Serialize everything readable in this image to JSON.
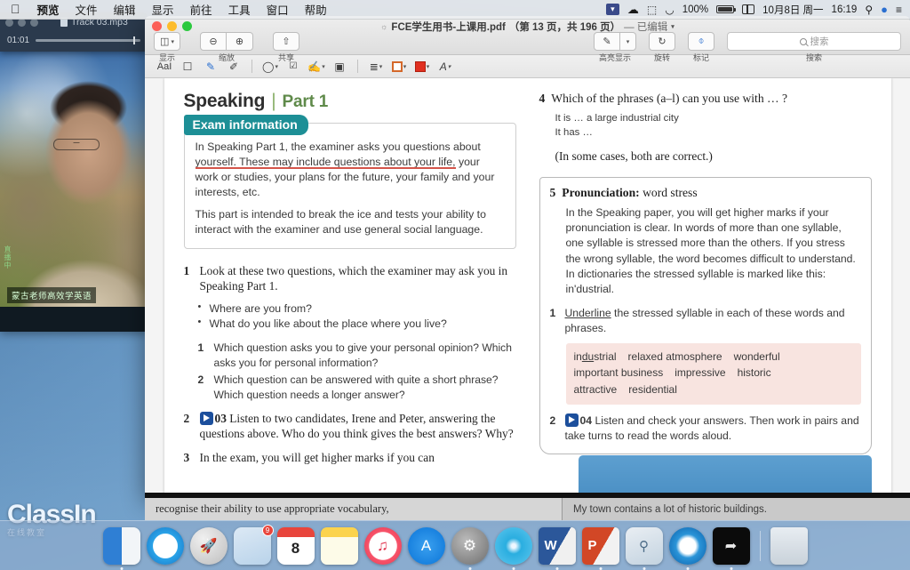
{
  "menubar": {
    "apple_icon": "apple-icon",
    "items": [
      "预览",
      "文件",
      "编辑",
      "显示",
      "前往",
      "工具",
      "窗口",
      "帮助"
    ],
    "status": {
      "battery_percent": "100%",
      "date": "10月8日 周一",
      "time": "16:19",
      "icons": [
        "flag-icon",
        "cloud-icon",
        "bluetooth-icon",
        "wifi-icon",
        "battery-icon",
        "control-center-icon",
        "search-icon",
        "siri-icon",
        "notification-center-icon"
      ]
    }
  },
  "audio_window": {
    "title": "Track 03.mp3",
    "current_time": "01:01"
  },
  "camera_panel": {
    "caption": "蒙古老师高效学英语",
    "vertical_label": "直播中"
  },
  "classin": {
    "name": "ClassIn",
    "tagline": "在线教室"
  },
  "pdf_window": {
    "title": "FCE学生用书-上课用.pdf",
    "page_info": "（第 13 页，共 196 页）",
    "edited_state": "— 已编辑",
    "toolbar": {
      "groups": [
        {
          "label": "显示",
          "buttons": [
            {
              "icon": "sidebar-icon",
              "caret": "▾"
            }
          ]
        },
        {
          "label": "缩放",
          "buttons": [
            {
              "icon": "zoom-out-icon"
            },
            {
              "icon": "zoom-in-icon"
            }
          ]
        },
        {
          "label": "共享",
          "buttons": [
            {
              "icon": "share-icon"
            }
          ]
        }
      ],
      "right_groups": [
        {
          "label": "高亮显示",
          "buttons": [
            {
              "icon": "highlighter-icon"
            },
            {
              "icon": "chevron-down-icon"
            }
          ]
        },
        {
          "label": "旋转",
          "buttons": [
            {
              "icon": "rotate-icon"
            }
          ]
        },
        {
          "label": "标记",
          "buttons": [
            {
              "icon": "markup-icon"
            }
          ]
        }
      ],
      "search_label": "搜索",
      "search_placeholder": "搜索"
    },
    "markup_bar": [
      {
        "icon": "text-select-icon",
        "glyph": "AaI"
      },
      {
        "icon": "rect-select-icon",
        "glyph": "▢"
      },
      {
        "icon": "instant-alpha-icon",
        "glyph": "✐"
      },
      {
        "icon": "sketch-icon",
        "glyph": "✎"
      },
      {
        "icon": "shapes-icon",
        "glyph": "◌",
        "caret": "▾"
      },
      {
        "icon": "text-box-icon",
        "glyph": "T"
      },
      {
        "icon": "signature-icon",
        "glyph": "✑",
        "caret": "▾"
      },
      {
        "icon": "note-icon",
        "glyph": "▣"
      },
      {
        "icon": "align-icon",
        "glyph": "≡",
        "caret": "▾"
      },
      {
        "icon": "border-style-icon",
        "glyph": "",
        "caret": "▾"
      },
      {
        "icon": "fill-color-icon",
        "glyph": "",
        "caret": "▾"
      },
      {
        "icon": "font-style-icon",
        "glyph": "A",
        "caret": "▾"
      }
    ]
  },
  "page_content": {
    "heading": {
      "title": "Speaking",
      "divider": "|",
      "part": "Part 1"
    },
    "exam_box": {
      "tag": "Exam information",
      "paragraph1_underlined": "In Speaking Part 1, the examiner asks you questions about yourself. These may include questions about your life,",
      "paragraph1_rest": "your work or studies, your plans for the future, your family and your interests, etc.",
      "paragraph2": "This part is intended to break the ice and tests your ability to interact with the examiner and use general social language."
    },
    "left_exercises": [
      {
        "number": "1",
        "text": "Look at these two questions, which the examiner may ask you in Speaking Part 1.",
        "bullets": [
          "Where are you from?",
          "What do you like about the place where you live?"
        ],
        "subitems": [
          {
            "number": "1",
            "text": "Which question asks you to give your personal opinion? Which asks you for personal information?"
          },
          {
            "number": "2",
            "text": "Which question can be answered with quite a short phrase? Which question needs a longer answer?"
          }
        ]
      },
      {
        "number": "2",
        "audio_icon": "play-icon",
        "audio_track": "03",
        "text": "Listen to two candidates, Irene and Peter, answering the questions above. Who do you think gives the best answers? Why?"
      },
      {
        "number": "3",
        "text": "In the exam, you will get higher marks if you can"
      }
    ],
    "right_exercises": [
      {
        "number": "4",
        "text": "Which of the phrases (a–l) can you use with … ?",
        "sub_lines": [
          "It is … a large industrial city",
          "It has …"
        ],
        "note": "(In some cases, both are correct.)"
      }
    ],
    "pronunciation_box": {
      "number": "5",
      "title_bold": "Pronunciation:",
      "title_rest": "word stress",
      "paragraph": "In the Speaking paper, you will get higher marks if your pronunciation is clear. In words of more than one syllable, one syllable is stressed more than the others. If you stress the wrong syllable, the word becomes difficult to understand. In dictionaries the stressed syllable is marked like this: in'dustrial.",
      "items": [
        {
          "number": "1",
          "underlined_word": "Underline",
          "text": " the stressed syllable in each of these words and phrases."
        },
        {
          "number": "2",
          "audio_icon": "play-icon",
          "audio_track": "04",
          "text": "Listen and check your answers. Then work in pairs and take turns to read the words aloud."
        }
      ],
      "word_list": [
        "industrial",
        "relaxed atmosphere",
        "wonderful",
        "important business",
        "impressive",
        "historic",
        "attractive",
        "residential"
      ],
      "word_list_stress": "du"
    }
  },
  "bottom_strip": {
    "hidden_line": "recognise their ability to use appropriate vocabulary,",
    "right_text": "My town contains a lot of historic buildings."
  },
  "dock": {
    "items": [
      {
        "name": "finder",
        "label": "Finder",
        "glyph": ""
      },
      {
        "name": "safari",
        "label": "Safari",
        "glyph": ""
      },
      {
        "name": "launchpad",
        "label": "Launchpad",
        "glyph": "🚀"
      },
      {
        "name": "mail",
        "label": "Mail",
        "glyph": "",
        "badge": "9"
      },
      {
        "name": "calendar",
        "label": "Calendar",
        "glyph": "8"
      },
      {
        "name": "notes",
        "label": "Notes",
        "glyph": ""
      },
      {
        "name": "itunes",
        "label": "iTunes",
        "glyph": "♪"
      },
      {
        "name": "app-store",
        "label": "App Store",
        "glyph": "A"
      },
      {
        "name": "system-preferences",
        "label": "System Preferences",
        "glyph": "⚙"
      },
      {
        "name": "wechat",
        "label": "WeChat",
        "glyph": ""
      },
      {
        "name": "microsoft-word",
        "label": "Word",
        "glyph": "W"
      },
      {
        "name": "powerpoint",
        "label": "PowerPoint",
        "glyph": "P"
      },
      {
        "name": "preview",
        "label": "Preview",
        "glyph": ""
      },
      {
        "name": "quicktime",
        "label": "QuickTime Player",
        "glyph": ""
      },
      {
        "name": "seagull-app",
        "label": "",
        "glyph": ""
      },
      {
        "name": "trash",
        "label": "Trash",
        "glyph": ""
      }
    ]
  }
}
